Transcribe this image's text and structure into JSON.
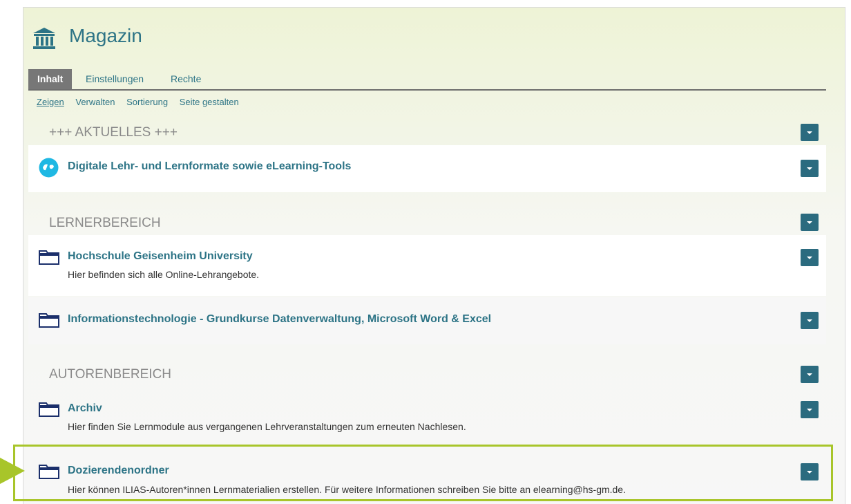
{
  "page": {
    "title": "Magazin",
    "title_icon": "bank-building-icon"
  },
  "tabs": [
    {
      "label": "Inhalt",
      "active": true
    },
    {
      "label": "Einstellungen",
      "active": false
    },
    {
      "label": "Rechte",
      "active": false
    }
  ],
  "subtabs": [
    {
      "label": "Zeigen",
      "active": true
    },
    {
      "label": "Verwalten",
      "active": false
    },
    {
      "label": "Sortierung",
      "active": false
    },
    {
      "label": "Seite gestalten",
      "active": false
    }
  ],
  "sections": {
    "aktuelles": {
      "heading": "+++ AKTUELLES +++",
      "items": [
        {
          "title": "Digitale Lehr- und Lernformate sowie eLearning-Tools",
          "icon": "web-link-icon"
        }
      ]
    },
    "lernerbereich": {
      "heading": "LERNERBEREICH",
      "items": [
        {
          "title": "Hochschule Geisenheim University",
          "description": "Hier befinden sich alle Online-Lehrangebote.",
          "icon": "folder-icon"
        },
        {
          "title": "Informationstechnologie - Grundkurse Datenverwaltung, Microsoft Word & Excel",
          "icon": "folder-icon"
        }
      ]
    },
    "autorenbereich": {
      "heading": "AUTORENBEREICH",
      "items": [
        {
          "title": "Archiv",
          "description": "Hier finden Sie Lernmodule aus vergangenen Lehrveranstaltungen zum erneuten Nachlesen.",
          "icon": "folder-icon"
        },
        {
          "title": "Dozierendenordner",
          "description": "Hier können ILIAS-Autoren*innen Lernmaterialien erstellen. Für weitere Informationen schreiben Sie bitte an elearning@hs-gm.de.",
          "icon": "folder-icon",
          "highlighted": true
        }
      ]
    }
  },
  "colors": {
    "accent": "#2d7486",
    "dropdown": "#2b6b7f",
    "highlight": "#a8c52a",
    "active_tab": "#777777"
  }
}
